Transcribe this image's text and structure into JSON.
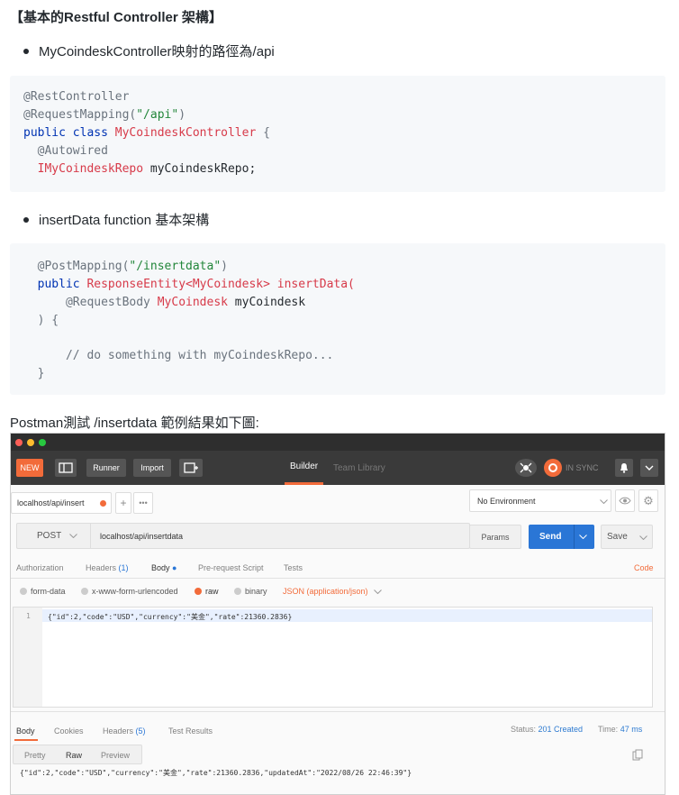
{
  "article": {
    "heading_prefix": "【基本的",
    "heading_bold": "Restful Controller",
    "heading_suffix": " 架構】",
    "bullet1": "MyCoindeskController映射的路徑為/api",
    "code1": {
      "l1": "@RestController",
      "l2_ann": "@RequestMapping(",
      "l2_str": "\"/api\"",
      "l2_close": ")",
      "l3_kw": "public class",
      "l3_cls": "MyCoindeskController",
      "l3_brace": " {",
      "l4": "  @Autowired",
      "l5_cls": "  IMyCoindeskRepo",
      "l5_txt": " myCoindeskRepo;"
    },
    "bullet2": "insertData function 基本架構",
    "code2": {
      "l1_ann": "  @PostMapping(",
      "l1_str": "\"/insertdata\"",
      "l1_close": ")",
      "l2_kw": "  public",
      "l2_cls": " ResponseEntity<MyCoindesk>",
      "l2_txt": " insertData(",
      "l3_ann": "      @RequestBody",
      "l3_cls": " MyCoindesk",
      "l3_txt": " myCoindesk",
      "l4": "  ) {",
      "l5": "      // do something with myCoindeskRepo...",
      "l6": "  }"
    },
    "para": "Postman測試 /insertdata 範例結果如下圖:"
  },
  "postman": {
    "toolbar": {
      "new": "NEW",
      "runner": "Runner",
      "import": "Import",
      "builder": "Builder",
      "team_library": "Team Library",
      "sync": "IN SYNC"
    },
    "tab_label": "localhost/api/insert",
    "environment": "No Environment",
    "method": "POST",
    "url": "localhost/api/insertdata",
    "params": "Params",
    "send": "Send",
    "save": "Save",
    "req_tabs": {
      "authorization": "Authorization",
      "headers": "Headers",
      "headers_count": "(1)",
      "body": "Body",
      "pre_request": "Pre-request Script",
      "tests": "Tests",
      "code": "Code"
    },
    "body_types": {
      "form_data": "form-data",
      "urlencoded": "x-www-form-urlencoded",
      "raw": "raw",
      "binary": "binary",
      "json": "JSON (application/json)"
    },
    "editor_line": "1",
    "editor_text": "{\"id\":2,\"code\":\"USD\",\"currency\":\"美金\",\"rate\":21360.2836}",
    "resp_tabs": {
      "body": "Body",
      "cookies": "Cookies",
      "headers": "Headers",
      "headers_count": "(5)",
      "tests": "Test Results"
    },
    "status_label": "Status:",
    "status_value": "201 Created",
    "time_label": "Time:",
    "time_value": "47 ms",
    "view_modes": {
      "pretty": "Pretty",
      "raw": "Raw",
      "preview": "Preview"
    },
    "response_text": "{\"id\":2,\"code\":\"USD\",\"currency\":\"美金\",\"rate\":21360.2836,\"updatedAt\":\"2022/08/26 22:46:39\"}",
    "colors": {
      "accent": "#f26b3a",
      "send_blue": "#2a76d6",
      "status_green": "#2e7bd1",
      "title_dark": "#2e2e2e",
      "toolbar_dark": "#3a3a3a"
    }
  }
}
